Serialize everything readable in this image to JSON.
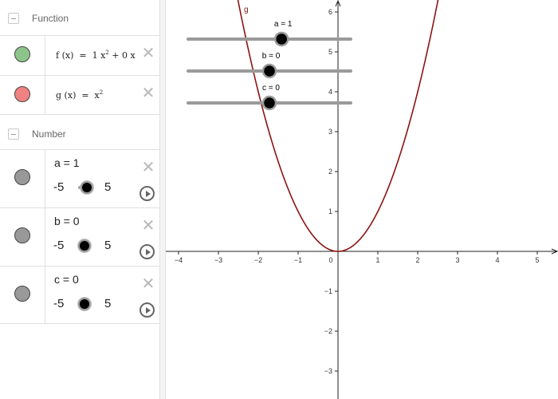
{
  "algebra": {
    "groups": {
      "function": "Function",
      "number": "Number"
    },
    "functions": [
      {
        "marble_color": "#8dc48a",
        "name": "f",
        "var": "x",
        "a_coef": "1",
        "b_coef": "0"
      },
      {
        "marble_color": "#f08282",
        "name": "g",
        "var": "x",
        "exp": "2"
      }
    ],
    "numbers": [
      {
        "def": "a = 1",
        "min": "-5",
        "max": "5",
        "value": 1
      },
      {
        "def": "b = 0",
        "min": "-5",
        "max": "5",
        "value": 0
      },
      {
        "def": "c = 0",
        "min": "-5",
        "max": "5",
        "value": 0
      }
    ],
    "delete_icon": "close-icon",
    "play_icon": "play-icon"
  },
  "graphics": {
    "x_ticks": [
      "−4",
      "−3",
      "−2",
      "−1",
      "0",
      "1",
      "2",
      "3",
      "4",
      "5"
    ],
    "y_ticks": [
      "6",
      "5",
      "4",
      "3",
      "2",
      "1",
      "−1",
      "−2",
      "−3"
    ],
    "curve_label": "g",
    "curve_color": "#8b1414",
    "sliders": [
      {
        "label": "a = 1",
        "value": 1,
        "min": -5,
        "max": 5
      },
      {
        "label": "b = 0",
        "value": 0,
        "min": -5,
        "max": 5
      },
      {
        "label": "c = 0",
        "value": 0,
        "min": -5,
        "max": 5
      }
    ]
  }
}
